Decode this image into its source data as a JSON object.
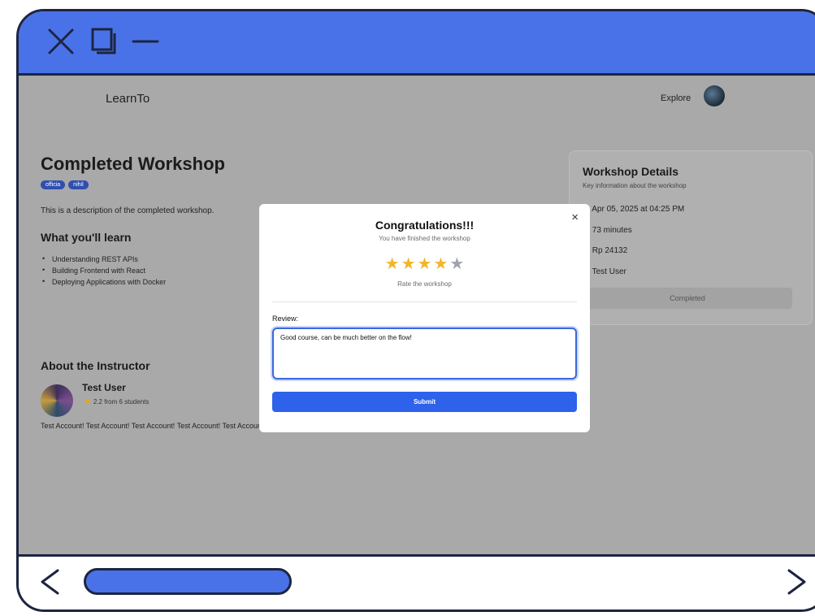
{
  "app": {
    "brand": "LearnTo",
    "explore_label": "Explore"
  },
  "workshop": {
    "title": "Completed Workshop",
    "tags": [
      "officia",
      "nihil"
    ],
    "description": "This is a description of the completed workshop.",
    "learn_title": "What you'll learn",
    "learn_items": [
      "Understanding REST APIs",
      "Building Frontend with React",
      "Deploying Applications with Docker"
    ]
  },
  "instructor": {
    "section_title": "About the Instructor",
    "name": "Test User",
    "rating": "2.2",
    "rating_suffix": "from 6 students",
    "bio": "Test Account! Test Account! Test Account! Test Account! Test Account!"
  },
  "details": {
    "title": "Workshop Details",
    "subtitle": "Key information about the workshop",
    "date": "Apr 05, 2025 at 04:25 PM",
    "duration": "73 minutes",
    "price": "Rp 24132",
    "host": "Test User",
    "status": "Completed"
  },
  "modal": {
    "close_glyph": "×",
    "title": "Congratulations!!!",
    "subtitle": "You have finished the workshop",
    "rating_value": 4,
    "rating_max": 5,
    "rate_label": "Rate the workshop",
    "review_label": "Review:",
    "review_text": "Good course, can be much better on the flow!",
    "submit_label": "Submit"
  },
  "colors": {
    "accent": "#4a72e8",
    "submit": "#2f62ea",
    "star_filled": "#f2b52c",
    "star_empty": "#9ea3ad",
    "outline": "#1c2541"
  },
  "icons": {
    "window": [
      "close-icon",
      "maximize-icon",
      "minimize-icon"
    ],
    "details": [
      "calendar-icon",
      "clock-icon",
      "price-icon",
      "user-icon"
    ],
    "nav": [
      "back-arrow-icon",
      "forward-arrow-icon"
    ]
  }
}
